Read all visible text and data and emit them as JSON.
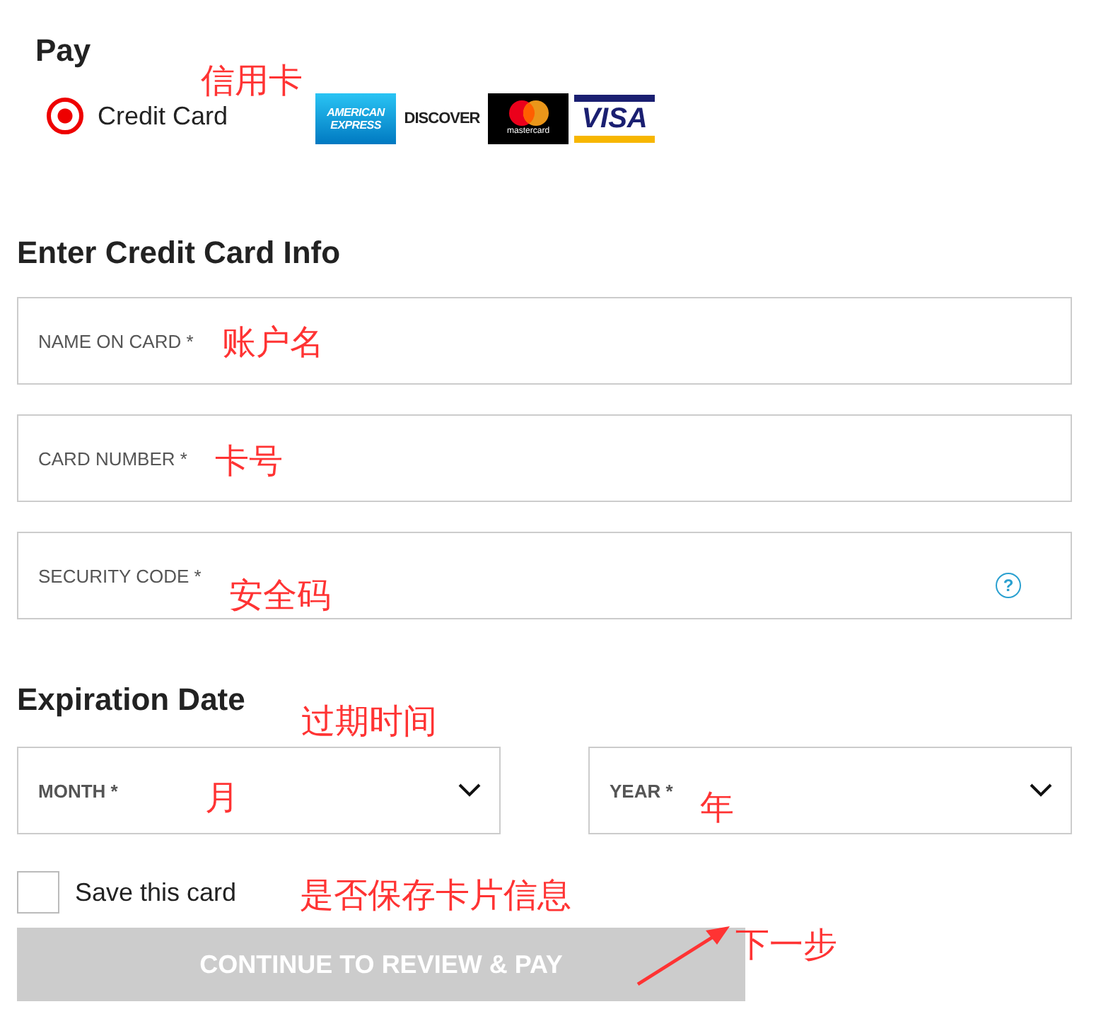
{
  "payment": {
    "title": "Pay",
    "methods": [
      {
        "label": "Credit Card",
        "selected": true
      }
    ],
    "card_logos": [
      {
        "kind": "amex",
        "label": "AMERICAN EXPRESS"
      },
      {
        "kind": "discover",
        "label": "DISCOVER"
      },
      {
        "kind": "mastercard",
        "label": "mastercard"
      },
      {
        "kind": "visa",
        "label": "VISA"
      }
    ]
  },
  "card_info": {
    "title": "Enter Credit Card Info",
    "fields": [
      {
        "placeholder": "NAME ON CARD *"
      },
      {
        "placeholder": "CARD NUMBER *"
      },
      {
        "placeholder": "SECURITY CODE *",
        "help": "?"
      }
    ]
  },
  "expiration": {
    "title": "Expiration Date",
    "selects": [
      {
        "placeholder": "MONTH *"
      },
      {
        "placeholder": "YEAR *"
      }
    ]
  },
  "save_card": {
    "label": "Save this card",
    "checked": false
  },
  "submit": {
    "label": "CONTINUE TO REVIEW & PAY",
    "disabled": true
  },
  "annotations": [
    {
      "text": "信用卡"
    },
    {
      "text": "账户名"
    },
    {
      "text": "卡号"
    },
    {
      "text": "安全码"
    },
    {
      "text": "过期时间"
    },
    {
      "text": "月"
    },
    {
      "text": "年"
    },
    {
      "text": "是否保存卡片信息"
    },
    {
      "text": "下一步"
    }
  ]
}
